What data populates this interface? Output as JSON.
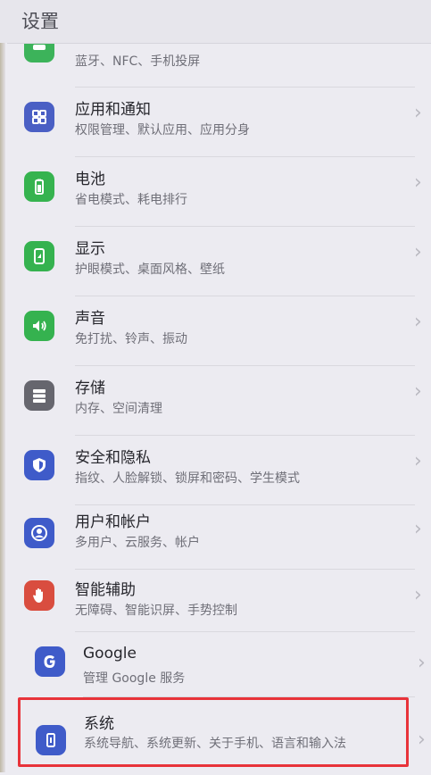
{
  "header": {
    "title": "设置"
  },
  "items": [
    {
      "title": "",
      "subtitle": "蓝牙、NFC、手机投屏",
      "icon": "device-connection-icon",
      "color": "#3cb35a"
    },
    {
      "title": "应用和通知",
      "subtitle": "权限管理、默认应用、应用分身",
      "icon": "apps-icon",
      "color": "#4a5fc4"
    },
    {
      "title": "电池",
      "subtitle": "省电模式、耗电排行",
      "icon": "battery-icon",
      "color": "#36b34f"
    },
    {
      "title": "显示",
      "subtitle": "护眼模式、桌面风格、壁纸",
      "icon": "display-icon",
      "color": "#35b24f"
    },
    {
      "title": "声音",
      "subtitle": "免打扰、铃声、振动",
      "icon": "sound-icon",
      "color": "#35b24f"
    },
    {
      "title": "存储",
      "subtitle": "内存、空间清理",
      "icon": "storage-icon",
      "color": "#66666e"
    },
    {
      "title": "安全和隐私",
      "subtitle": "指纹、人脸解锁、锁屏和密码、学生模式",
      "icon": "shield-icon",
      "color": "#3f5bc9"
    },
    {
      "title": "用户和帐户",
      "subtitle": "多用户、云服务、帐户",
      "icon": "user-icon",
      "color": "#3f5bc9"
    },
    {
      "title": "智能辅助",
      "subtitle": "无障碍、智能识屏、手势控制",
      "icon": "hand-icon",
      "color": "#d94d3f"
    },
    {
      "title": "Google",
      "subtitle": "管理 Google 服务",
      "icon": "google-icon",
      "color": "#3f5bc9"
    },
    {
      "title": "系统",
      "subtitle": "系统导航、系统更新、关于手机、语言和输入法",
      "icon": "system-icon",
      "color": "#3f5bc9"
    }
  ],
  "chevron": "›"
}
